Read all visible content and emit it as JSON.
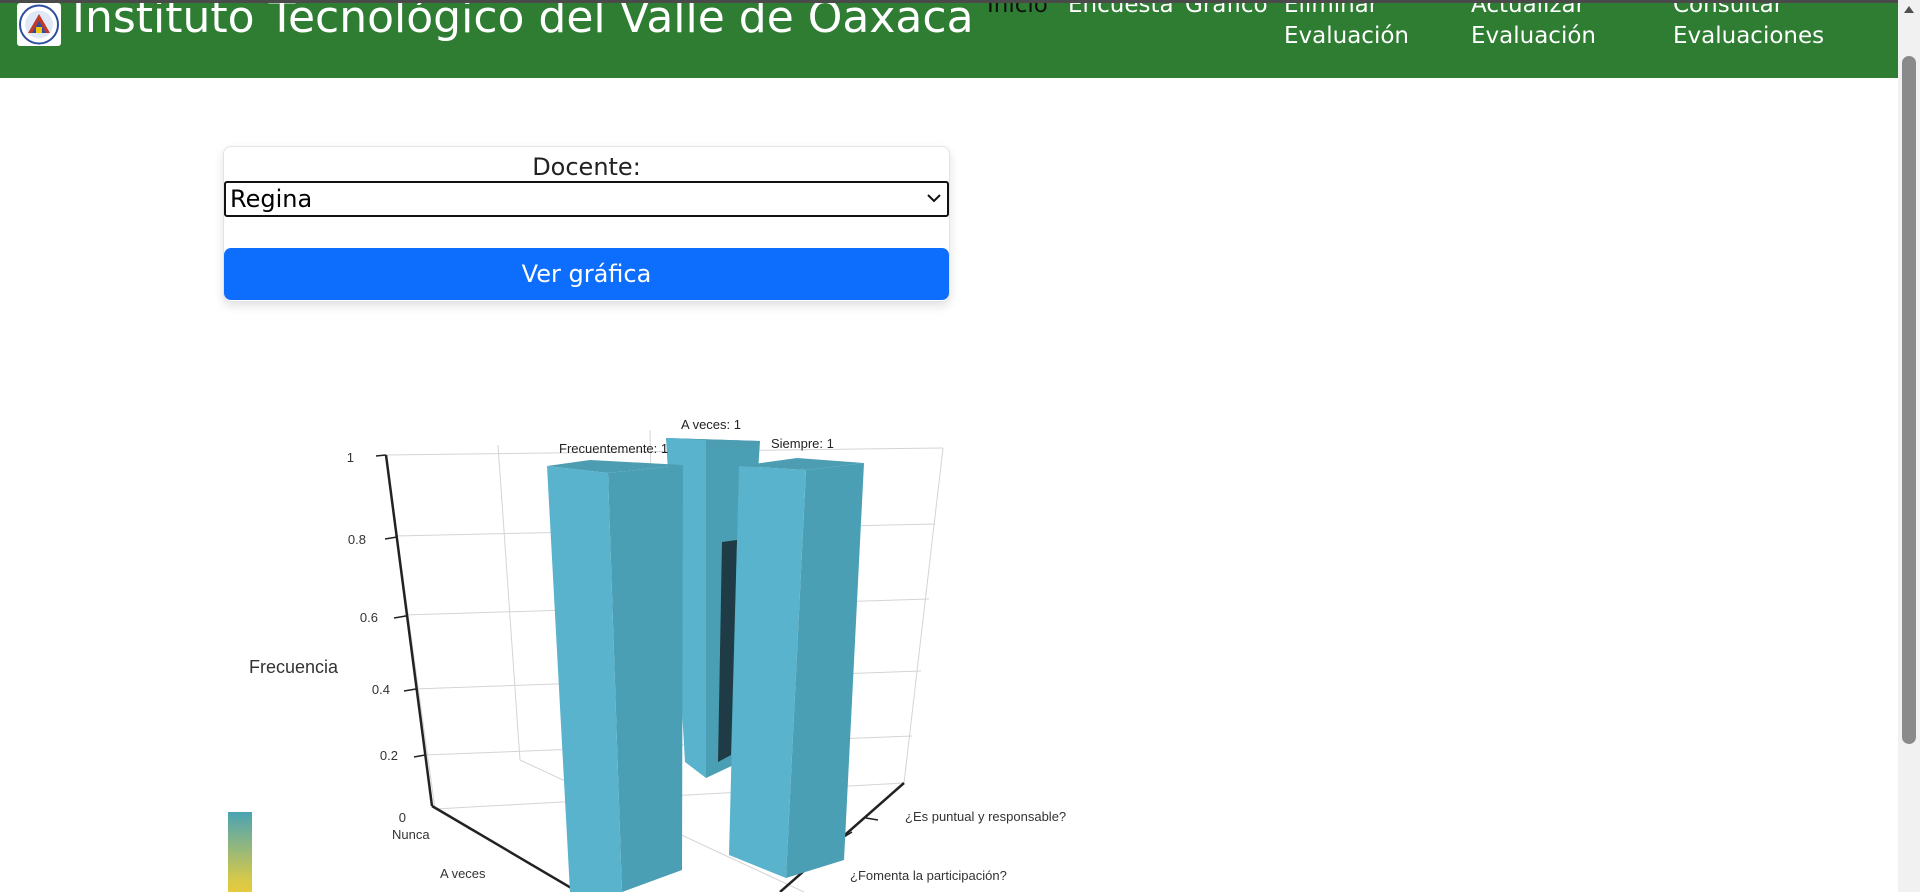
{
  "navbar": {
    "brand": "Instituto Tecnológico del Valle de Oaxaca",
    "items": [
      {
        "label": "Inicio"
      },
      {
        "label": "Encuesta"
      },
      {
        "label": "Grafico"
      },
      {
        "label": "Eliminar Evaluación",
        "line1": "Eliminar",
        "line2": "Evaluación"
      },
      {
        "label": "Actualizar Evaluación",
        "line1": "Actualizar",
        "line2": "Evaluación"
      },
      {
        "label": "Consultar Evaluaciones",
        "line1": "Consultar",
        "line2": "Evaluaciones"
      }
    ]
  },
  "form": {
    "docente_label": "Docente:",
    "docente_value": "Regina",
    "submit_label": "Ver gráfica"
  },
  "colors": {
    "navbar": "#2e7d32",
    "primary": "#0d6efd",
    "bar_face": "#5ab3cc",
    "bar_side": "#4a9fb5"
  },
  "chart_data": {
    "type": "bar",
    "ylabel": "Frecuencia",
    "ylim": [
      0,
      1
    ],
    "yticks": [
      "0",
      "0.2",
      "0.4",
      "0.6",
      "0.8",
      "1"
    ],
    "x_categories": [
      "Nunca",
      "A veces"
    ],
    "z_categories": [
      "¿Es puntual y responsable?",
      "¿Fomenta la participación?"
    ],
    "bars": [
      {
        "label": "Frecuentemente: 1",
        "value": 1
      },
      {
        "label": "A veces: 1",
        "value": 1
      },
      {
        "label": "Siempre: 1",
        "value": 1
      }
    ]
  }
}
